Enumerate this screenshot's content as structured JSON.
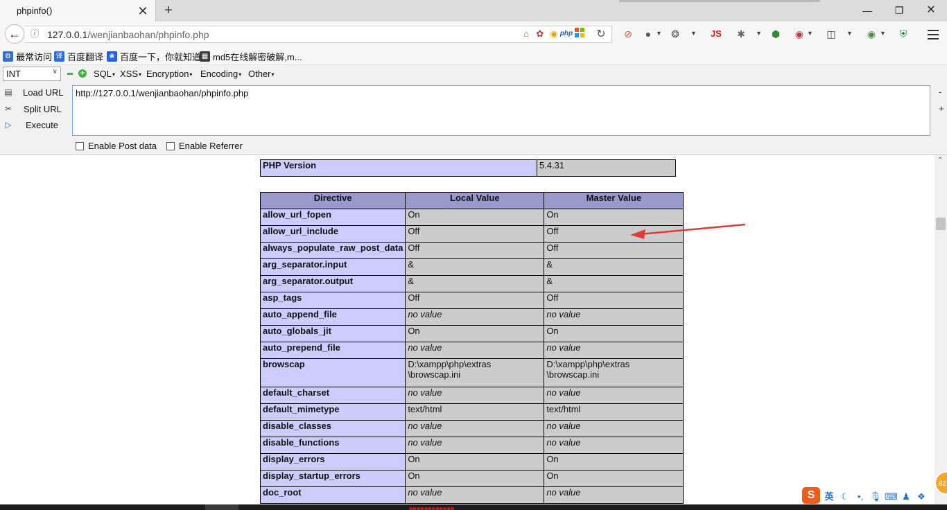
{
  "browser": {
    "tab_title": "phpinfo()",
    "tab_close": "✕",
    "new_tab": "+",
    "url_host": "127.0.0.1",
    "url_path": "/wenjianbaohan/phpinfo.php"
  },
  "bookmarks": [
    {
      "label": "最常访问",
      "icon": "gear-icon"
    },
    {
      "label": "百度翻译",
      "icon": "translate-icon"
    },
    {
      "label": "百度一下，你就知道",
      "icon": "baidu-paw-icon"
    },
    {
      "label": "md5在线解密破解,m...",
      "icon": "grid-icon"
    }
  ],
  "toolbar_icons": {
    "js_label": "JS",
    "php_label": "php"
  },
  "hackbar": {
    "select_value": "INT",
    "menus": [
      "SQL",
      "XSS",
      "Encryption",
      "Encoding",
      "Other"
    ],
    "load_url": "Load URL",
    "split_url": "Split URL",
    "execute": "Execute",
    "url_value": "http://127.0.0.1/wenjianbaohan/phpinfo.php",
    "side_minus": "-",
    "side_plus": "+",
    "enable_post": "Enable Post data",
    "enable_referrer": "Enable Referrer"
  },
  "phpinfo": {
    "version_label": "PHP Version",
    "version_value": "5.4.31",
    "headers": [
      "Directive",
      "Local Value",
      "Master Value"
    ],
    "rows": [
      {
        "directive": "allow_url_fopen",
        "local": "On",
        "master": "On",
        "novalue": false
      },
      {
        "directive": "allow_url_include",
        "local": "Off",
        "master": "Off",
        "novalue": false
      },
      {
        "directive": "always_populate_raw_post_data",
        "local": "Off",
        "master": "Off",
        "novalue": false
      },
      {
        "directive": "arg_separator.input",
        "local": "&",
        "master": "&",
        "novalue": false
      },
      {
        "directive": "arg_separator.output",
        "local": "&",
        "master": "&",
        "novalue": false
      },
      {
        "directive": "asp_tags",
        "local": "Off",
        "master": "Off",
        "novalue": false
      },
      {
        "directive": "auto_append_file",
        "local": "no value",
        "master": "no value",
        "novalue": true
      },
      {
        "directive": "auto_globals_jit",
        "local": "On",
        "master": "On",
        "novalue": false
      },
      {
        "directive": "auto_prepend_file",
        "local": "no value",
        "master": "no value",
        "novalue": true
      },
      {
        "directive": "browscap",
        "local": "D:\\xampp\\php\\extras\n\\browscap.ini",
        "master": "D:\\xampp\\php\\extras\n\\browscap.ini",
        "novalue": false,
        "tall": true
      },
      {
        "directive": "default_charset",
        "local": "no value",
        "master": "no value",
        "novalue": true
      },
      {
        "directive": "default_mimetype",
        "local": "text/html",
        "master": "text/html",
        "novalue": false
      },
      {
        "directive": "disable_classes",
        "local": "no value",
        "master": "no value",
        "novalue": true
      },
      {
        "directive": "disable_functions",
        "local": "no value",
        "master": "no value",
        "novalue": true
      },
      {
        "directive": "display_errors",
        "local": "On",
        "master": "On",
        "novalue": false
      },
      {
        "directive": "display_startup_errors",
        "local": "On",
        "master": "On",
        "novalue": false
      },
      {
        "directive": "doc_root",
        "local": "no value",
        "master": "no value",
        "novalue": true
      }
    ]
  },
  "tray": {
    "ime_logo": "S",
    "ime_lang": "英",
    "badge": "82"
  },
  "colors": {
    "directive_bg": "#ccccff",
    "value_bg": "#cccccc",
    "header_bg": "#9999cc",
    "arrow": "#e53935"
  }
}
